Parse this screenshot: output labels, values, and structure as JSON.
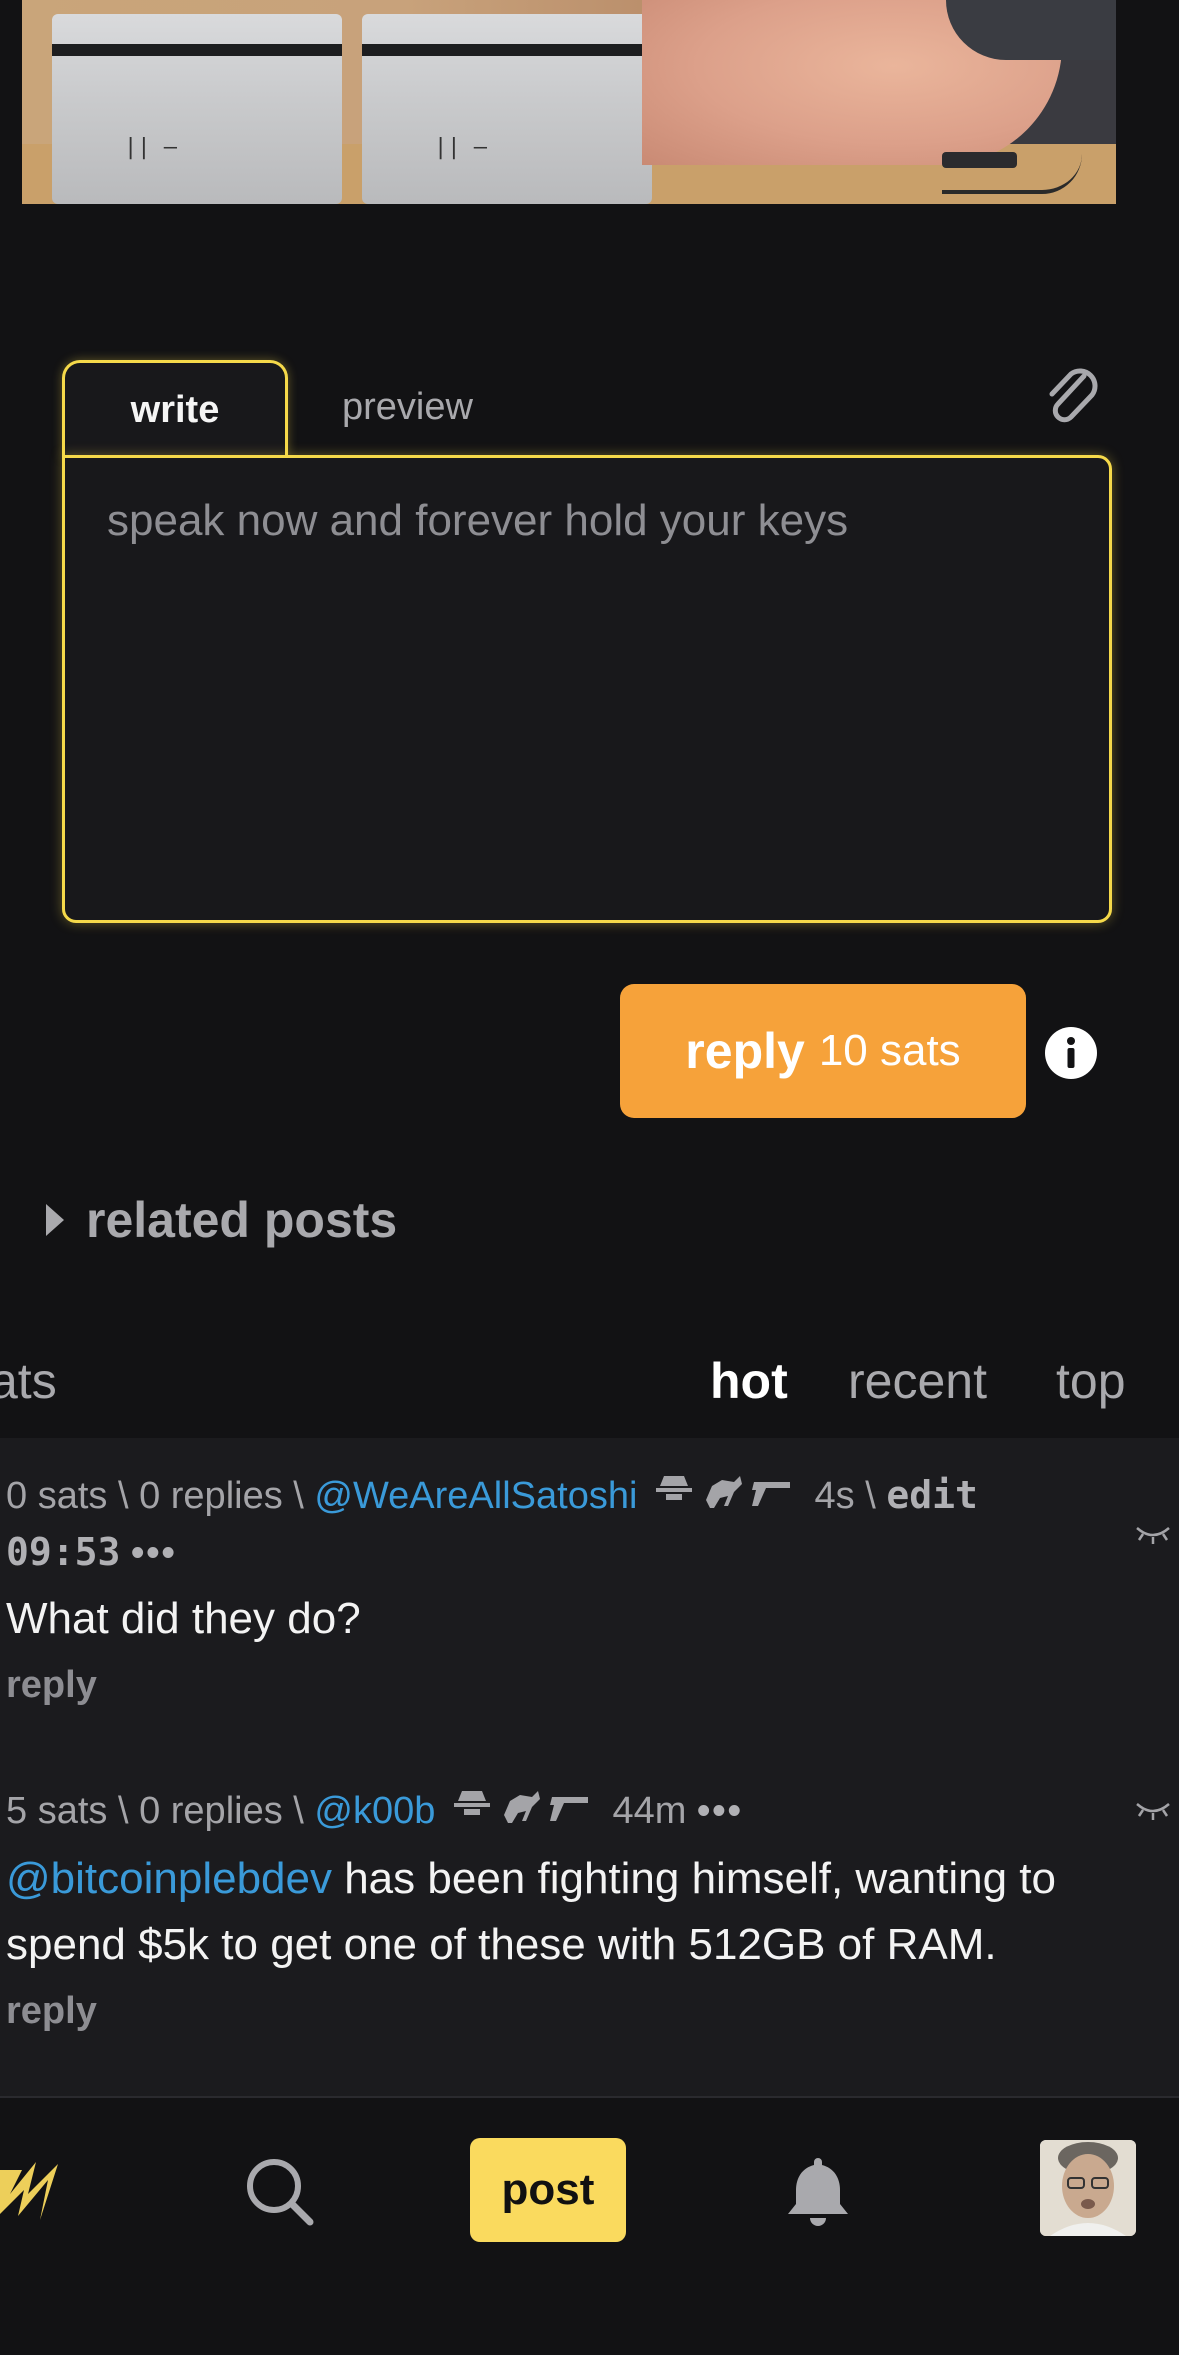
{
  "editor": {
    "tab_write": "write",
    "tab_preview": "preview",
    "placeholder": "speak now and forever hold your keys"
  },
  "reply_button": {
    "label": "reply",
    "cost": "10 sats"
  },
  "related": {
    "label": "related posts"
  },
  "sort": {
    "partial_label": "ats",
    "options": [
      "hot",
      "recent",
      "top"
    ],
    "active": "hot"
  },
  "comments": [
    {
      "sats": "0 sats",
      "replies": "0 replies",
      "user": "@WeAreAllSatoshi",
      "age": "4s",
      "edit": "edit",
      "edit_time": "09:53",
      "more": "•••",
      "body": "What did they do?",
      "reply": "reply"
    },
    {
      "sats": "5 sats",
      "replies": "0 replies",
      "user": "@k00b",
      "age": "44m",
      "more": "•••",
      "mention": "@bitcoinplebdev",
      "body": " has been fighting himself, wanting to spend $5k to get one of these with 512GB of RAM.",
      "reply": "reply"
    }
  ],
  "nav": {
    "post_label": "post"
  },
  "colors": {
    "accent": "#fada5e",
    "reply": "#f6a23a",
    "link": "#3a9ad9"
  }
}
